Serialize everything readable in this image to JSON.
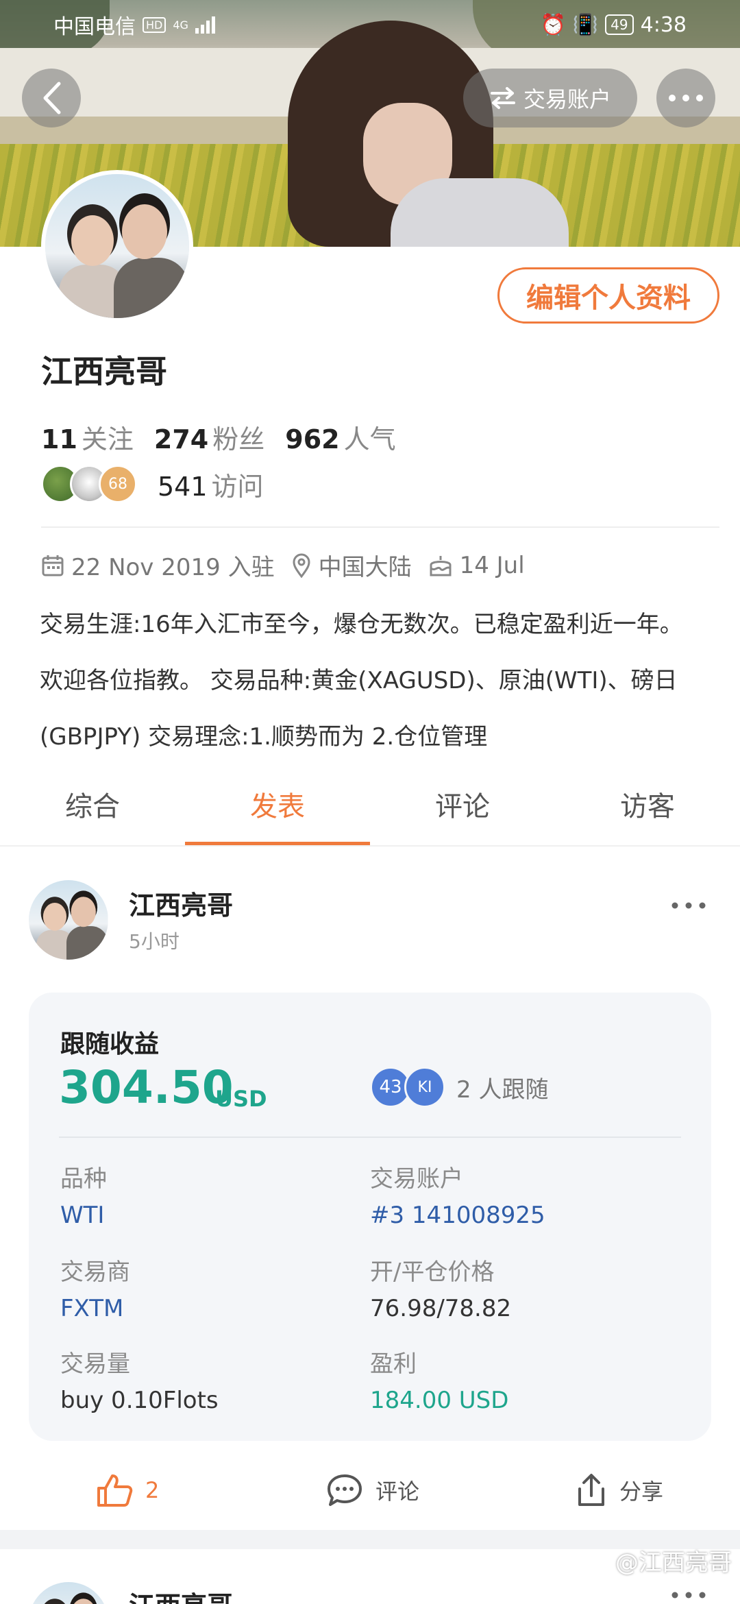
{
  "status": {
    "carrier": "中国电信",
    "hd": "HD",
    "network": "4G",
    "battery": "49",
    "time": "4:38"
  },
  "header": {
    "back_icon": "chevron-left-icon",
    "switch_label": "交易账户",
    "switch_icon": "swap-icon",
    "more_icon": "more-dots-icon"
  },
  "profile": {
    "edit_label": "编辑个人资料",
    "name": "江西亮哥",
    "stats": [
      {
        "value": "11",
        "label": "关注"
      },
      {
        "value": "274",
        "label": "粉丝"
      },
      {
        "value": "962",
        "label": "人气"
      }
    ],
    "visitor_badge": "68",
    "visits_value": "541",
    "visits_label": "访问",
    "joined": "22 Nov 2019 入驻",
    "location": "中国大陆",
    "birthday": "14 Jul",
    "bio_lines": [
      "交易生涯:16年入汇市至今，爆仓无数次。已稳定盈利近一年。",
      "欢迎各位指教。 交易品种:黄金(XAGUSD)、原油(WTI)、磅日",
      "(GBPJPY) 交易理念:1.顺势而为 2.仓位管理"
    ]
  },
  "tabs": [
    {
      "label": "综合",
      "active": false
    },
    {
      "label": "发表",
      "active": true
    },
    {
      "label": "评论",
      "active": false
    },
    {
      "label": "访客",
      "active": false
    }
  ],
  "post": {
    "author": "江西亮哥",
    "time": "5小时",
    "card": {
      "title": "跟随收益",
      "amount": "304.50",
      "unit": "USD",
      "follower_badges": [
        "43",
        "KI"
      ],
      "followers_text": "2 人跟随",
      "fields": [
        {
          "key": "品种",
          "value": "WTI",
          "style": "link"
        },
        {
          "key": "交易账户",
          "value": "#3 141008925",
          "style": "link"
        },
        {
          "key": "交易商",
          "value": "FXTM",
          "style": "link"
        },
        {
          "key": "开/平仓价格",
          "value": "76.98/78.82",
          "style": "plain"
        },
        {
          "key": "交易量",
          "value": "buy 0.10Flots",
          "style": "plain"
        },
        {
          "key": "盈利",
          "value": "184.00 USD",
          "style": "green"
        }
      ]
    },
    "actions": {
      "like_count": "2",
      "comment_label": "评论",
      "share_label": "分享"
    }
  },
  "next_post": {
    "author": "江西亮哥"
  },
  "watermark": "@江西亮哥",
  "colors": {
    "accent": "#f07a3c",
    "profit": "#1ea58c",
    "link": "#2f5da8"
  }
}
